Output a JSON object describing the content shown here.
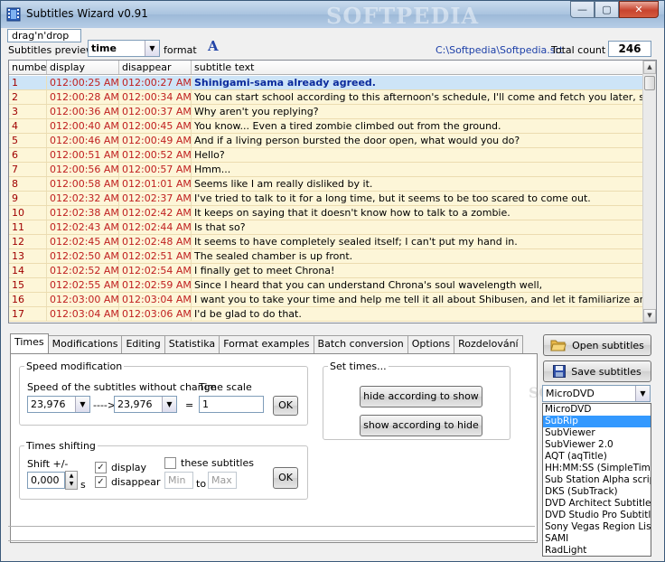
{
  "window": {
    "title": "Subtitles Wizard v0.91",
    "watermark": "SOFTPEDIA",
    "minimize": "—",
    "maximize": "▢",
    "close": "✕"
  },
  "toolbar": {
    "drag_label": "drag'n'drop",
    "preview_label": "Subtitles preview:",
    "preview_value": "time",
    "format_label": "format",
    "font_glyph": "A",
    "file_path": "C:\\Softpedia\\Softpedia.srt",
    "count_label": "Total count",
    "count_value": "246"
  },
  "grid": {
    "columns": [
      "number",
      "display",
      "disappear",
      "subtitle text"
    ],
    "rows": [
      [
        "1",
        "012:00:25 AM,4",
        "012:00:27 AM,3",
        "Shinigami-sama already agreed."
      ],
      [
        "2",
        "012:00:28 AM,1",
        "012:00:34 AM,4",
        "You can start school according to this afternoon's schedule, I'll come and fetch you later, so prepare your"
      ],
      [
        "3",
        "012:00:36 AM,9",
        "012:00:37 AM,8",
        "Why aren't you replying?"
      ],
      [
        "4",
        "012:00:40 AM,9",
        "012:00:45 AM,8",
        "You know... Even a tired zombie climbed out from the ground."
      ],
      [
        "5",
        "012:00:46 AM,4",
        "012:00:49 AM,8",
        "And if a living person bursted the door open, what would you do?"
      ],
      [
        "6",
        "012:00:51 AM,5",
        "012:00:52 AM,3",
        "Hello?"
      ],
      [
        "7",
        "012:00:56 AM,6",
        "012:00:57 AM,6",
        "Hmm..."
      ],
      [
        "8",
        "012:00:58 AM,8",
        "012:01:01 AM,0",
        "Seems like I am really disliked by it."
      ],
      [
        "9",
        "012:02:32 AM,6",
        "012:02:37 AM,4",
        "I've tried to talk to it for a long time, but it seems to be too scared to come out."
      ],
      [
        "10",
        "012:02:38 AM,6",
        "012:02:42 AM,2",
        "It keeps on saying that it doesn't know how to talk to a zombie."
      ],
      [
        "11",
        "012:02:43 AM,2",
        "012:02:44 AM,4",
        "Is that so?"
      ],
      [
        "12",
        "012:02:45 AM,1",
        "012:02:48 AM,8",
        "It seems to have completely sealed itself; I can't put my hand in."
      ],
      [
        "13",
        "012:02:50 AM,2",
        "012:02:51 AM,8",
        "The sealed chamber is up front."
      ],
      [
        "14",
        "012:02:52 AM,6",
        "012:02:54 AM,3",
        "I finally get to meet Chrona!"
      ],
      [
        "15",
        "012:02:55 AM,2",
        "012:02:59 AM,2",
        "Since I heard that you can understand Chrona's soul wavelength well,"
      ],
      [
        "16",
        "012:03:00 AM,2",
        "012:03:04 AM,2",
        "I want you to take your time and help me tell it all about Shibusen, and let it familiarize around here."
      ],
      [
        "17",
        "012:03:04 AM,9",
        "012:03:06 AM,6",
        "I'd be glad to do that."
      ]
    ]
  },
  "tabs": [
    "Times",
    "Modifications",
    "Editing",
    "Statistika",
    "Format examples",
    "Batch conversion",
    "Options",
    "Rozdelování"
  ],
  "speed": {
    "legend": "Speed modification",
    "without_change_label": "Speed of the subtitles without change",
    "from_value": "23,976",
    "arrow": "---->",
    "to_value": "23,976",
    "equals": "=",
    "time_scale_label": "Time scale",
    "time_scale_value": "1",
    "ok": "OK"
  },
  "set_times": {
    "legend": "Set times...",
    "hide_button": "hide according to show",
    "show_button": "show according to hide"
  },
  "shifting": {
    "legend": "Times shifting",
    "shift_label": "Shift +/-",
    "shift_value": "0,000",
    "unit": "s",
    "display_label": "display",
    "disappear_label": "disappear",
    "these_label": "these subtitles",
    "min_placeholder": "Min",
    "to_label": "to",
    "max_placeholder": "Max",
    "ok": "OK"
  },
  "right": {
    "open_button": "Open subtitles",
    "save_button": "Save subtitles",
    "format_selected": "MicroDVD",
    "format_watermark": "SOFTPEDIA",
    "format_options": [
      "MicroDVD",
      "SubRip",
      "SubViewer",
      "SubViewer 2.0",
      "AQT (aqTitle)",
      "HH:MM:SS (SimpleTime)",
      "Sub Station Alpha script",
      "DKS (SubTrack)",
      "DVD Architect Subtitle S",
      "DVD Studio Pro Subtitle",
      "Sony Vegas Region List",
      "SAMI",
      "RadLight"
    ],
    "highlighted_index": 1
  },
  "colors": {
    "row_bg": "#fdf6d8",
    "selected_row_bg": "#cde4f7",
    "time_text": "#c02020",
    "highlight": "#3399ff"
  }
}
